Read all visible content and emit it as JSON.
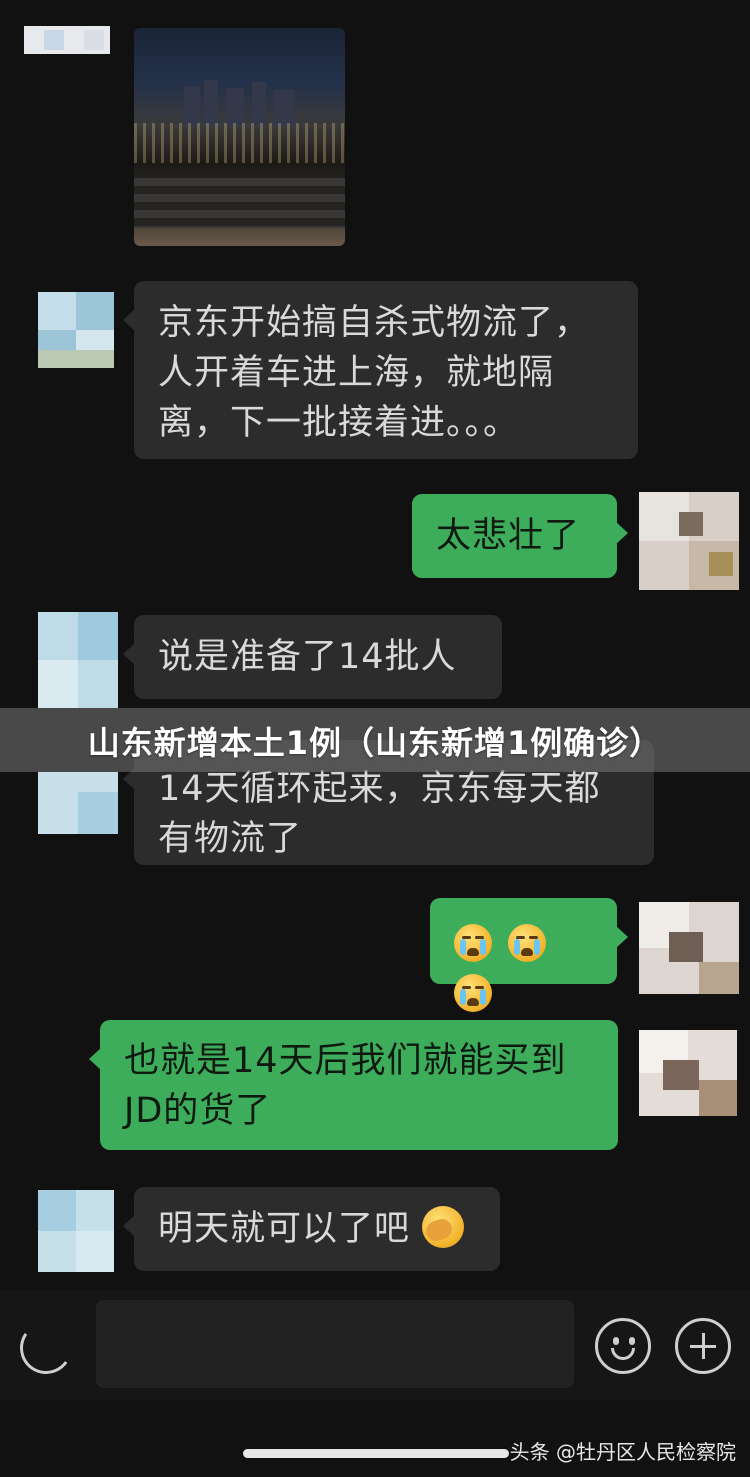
{
  "banner": {
    "title": "山东新增本土1例（山东新增1例确诊）"
  },
  "messages": [
    {
      "side": "in",
      "lines": [
        "京东开始搞自杀式物流了，",
        "人开着车进上海，就地隔",
        "离，下一批接着进。。。"
      ]
    },
    {
      "side": "out",
      "text": "太悲壮了"
    },
    {
      "side": "in",
      "text": "说是准备了14批人"
    },
    {
      "side": "in",
      "lines": [
        "14天循环起来，京东每天都",
        "有物流了"
      ]
    },
    {
      "side": "out",
      "emoji": [
        "loudly-crying-face-emoji",
        "loudly-crying-face-emoji",
        "loudly-crying-face-emoji"
      ]
    },
    {
      "side": "out",
      "lines": [
        "也就是14天后我们就能买到",
        "JD的货了"
      ]
    },
    {
      "side": "in",
      "text": "明天就可以了吧",
      "emoji": "face-palm-emoji"
    }
  ],
  "watermark": "头条 @牡丹区人民检察院",
  "colors": {
    "background": "#111111",
    "incoming_bubble": "#2c2c2c",
    "outgoing_bubble": "#3ead5b",
    "banner": "#787878"
  },
  "icons": {
    "voice": "voice-icon",
    "emoji": "smiley-icon",
    "more": "plus-icon"
  }
}
